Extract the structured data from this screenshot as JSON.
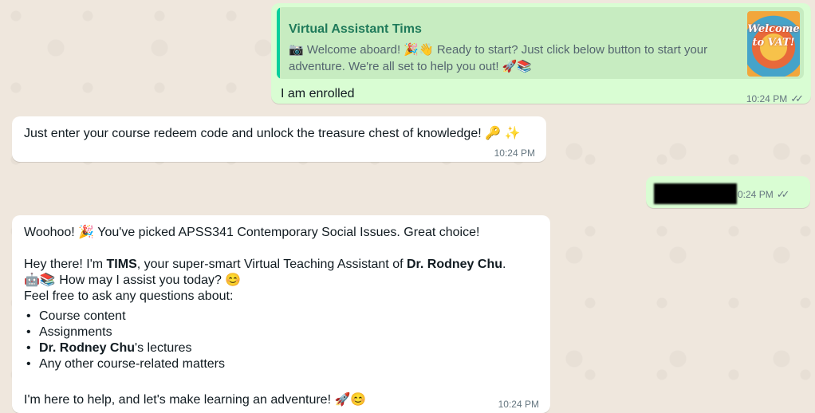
{
  "messages": {
    "m1": {
      "quote_author": "Virtual Assistant Tims",
      "quote_text": "📷 Welcome aboard! 🎉👋 Ready to start? Just click below button to start your adventure. We're all set to help you out! 🚀📚",
      "quote_image_text": "Welcome to VAT!",
      "text": "I am enrolled",
      "time": "10:24 PM",
      "status_icon": "double-check-icon"
    },
    "m2": {
      "text": "Just enter your course redeem code and unlock the treasure chest of knowledge! 🔑 ✨",
      "time": "10:24 PM"
    },
    "m3": {
      "time": "0:24 PM",
      "status_icon": "double-check-icon"
    },
    "m4": {
      "line1": "Woohoo! 🎉 You've picked APSS341 Contemporary Social Issues. Great choice!",
      "line2a": " Hey there! I'm ",
      "line2b": "TIMS",
      "line2c": ", your super-smart Virtual Teaching Assistant of ",
      "line2d": "Dr. Rodney Chu",
      "line2e": ".",
      "line3": "🤖📚  How may I assist you today? 😊",
      "line4": "Feel free to ask any questions about:",
      "list": {
        "i1": "Course content",
        "i2": "Assignments",
        "i3a": "Dr. Rodney Chu",
        "i3b": "'s lectures",
        "i4": "Any other course-related matters"
      },
      "closing": "I'm here to help, and let's make learning an adventure! 🚀😊",
      "time": "10:24 PM"
    }
  },
  "colors": {
    "outgoing_bubble": "#d9fdd3",
    "incoming_bubble": "#ffffff",
    "quote_accent": "#06cf9c",
    "background": "#efe7dd"
  }
}
